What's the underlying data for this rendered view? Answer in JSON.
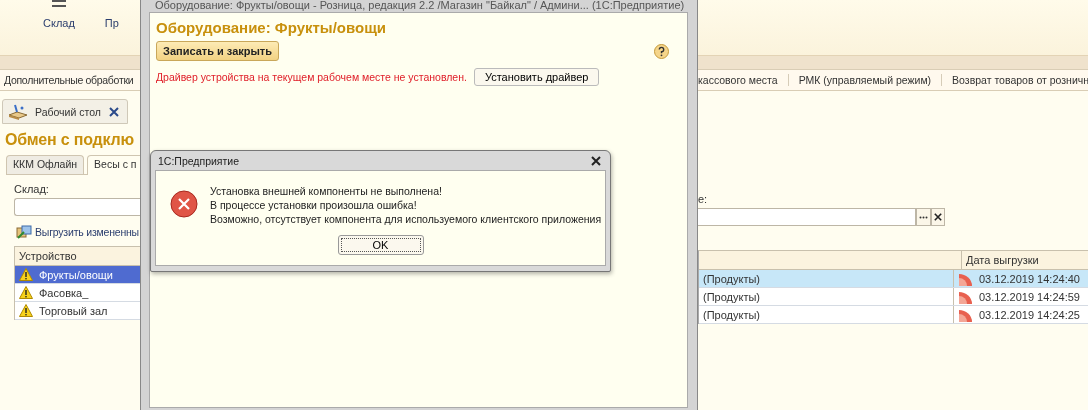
{
  "toolbar": {
    "items": [
      {
        "label": "Склад"
      },
      {
        "label": "Пр"
      }
    ]
  },
  "nav_bar": {
    "left_items": [
      "Дополнительные обработки"
    ],
    "right_items": [
      "кассового места",
      "РМК (управляемый режим)",
      "Возврат товаров от розничн"
    ]
  },
  "open_tabs": [
    {
      "label": "Рабочий стол",
      "selected": true
    }
  ],
  "page": {
    "title": "Обмен с подклю",
    "tabs": [
      {
        "label": "ККМ Офлайн",
        "selected": false
      },
      {
        "label": "Весы с п",
        "selected": true
      }
    ],
    "warehouse_label": "Склад:",
    "right_label": "е:",
    "export_button": "Выгрузить измененны",
    "table": {
      "columns": [
        "Устройство",
        "Дата выгрузки"
      ],
      "rows": [
        {
          "device": "Фрукты/овощи",
          "column_2": "(Продукты)",
          "date": "03.12.2019 14:24:40",
          "selected": true
        },
        {
          "device": "Фасовка_",
          "column_2": "(Продукты)",
          "date": "03.12.2019 14:24:59",
          "selected": false
        },
        {
          "device": "Торговый зал",
          "column_2": "(Продукты)",
          "date": "03.12.2019 14:24:25",
          "selected": false
        }
      ]
    }
  },
  "form_window": {
    "title": "Оборудование: Фрукты/овощи - Розница, редакция 2.2 /Магазин \"Байкал\" / Админи... (1С:Предприятие)",
    "heading": "Оборудование: Фрукты/овощи",
    "save_button": "Записать и закрыть",
    "warning": "Драйвер устройства на текущем рабочем месте не установлен.",
    "install_button": "Установить драйвер"
  },
  "dialog": {
    "title": "1С:Предприятие",
    "lines": [
      "Установка внешней компоненты не выполнена!",
      "В процессе установки произошла ошибка!",
      "Возможно, отсутствует компонента для используемого клиентского приложения"
    ],
    "ok_button": "OK"
  }
}
